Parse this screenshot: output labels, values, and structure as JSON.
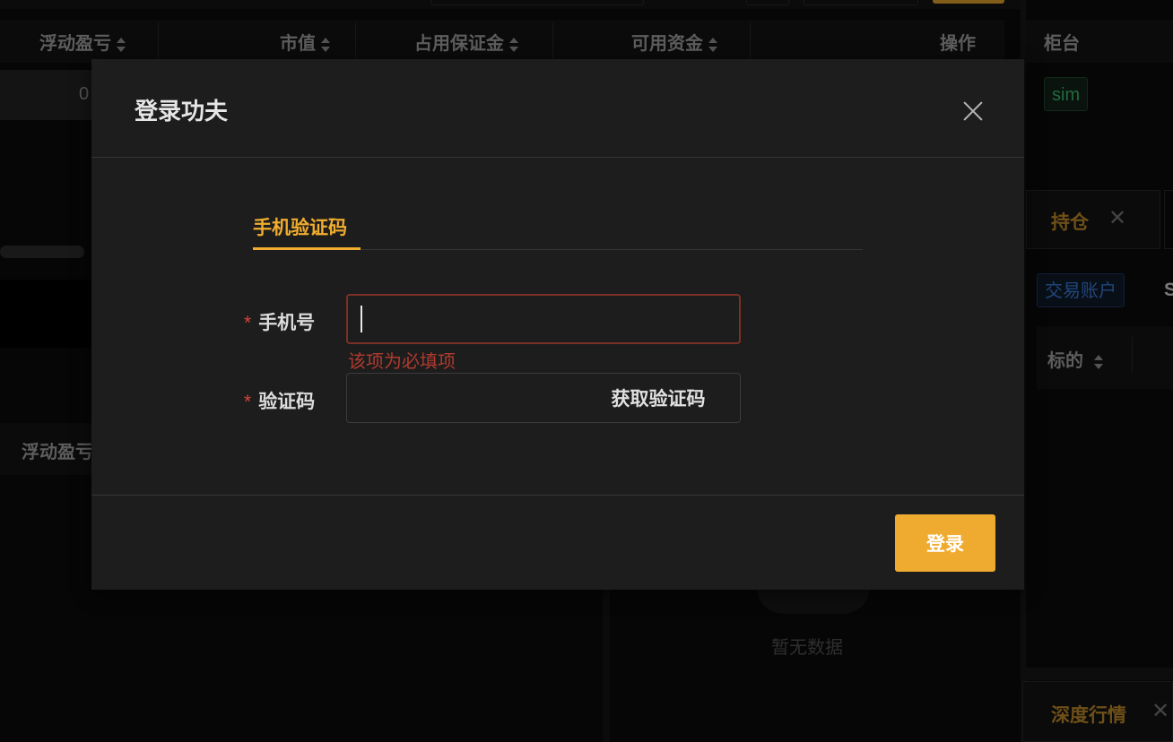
{
  "background": {
    "table_headers": [
      "浮动盈亏",
      "市值",
      "占用保证金",
      "可用资金",
      "操作"
    ],
    "first_cell": "0",
    "left_lower_header": "浮动盈亏",
    "empty_text": "暂无数据",
    "right_panel": {
      "counter_header": "柜台",
      "counter_tag": "sim",
      "tab_positions": "持仓",
      "trading_account_tag": "交易账户",
      "trading_account_tail": "S",
      "symbol_header": "标的",
      "tab_depth": "深度行情"
    }
  },
  "dialog": {
    "title": "登录功夫",
    "tab_label": "手机验证码",
    "phone_label": "手机号",
    "phone_value": "",
    "phone_error": "该项为必填项",
    "code_label": "验证码",
    "code_value": "",
    "get_code_button": "获取验证码",
    "login_button": "登录",
    "required_mark": "*"
  },
  "colors": {
    "accent": "#f0ad2e",
    "error": "#d9443b",
    "sim_tag": "#3fbf6f",
    "account_tag": "#3d7ee0"
  }
}
